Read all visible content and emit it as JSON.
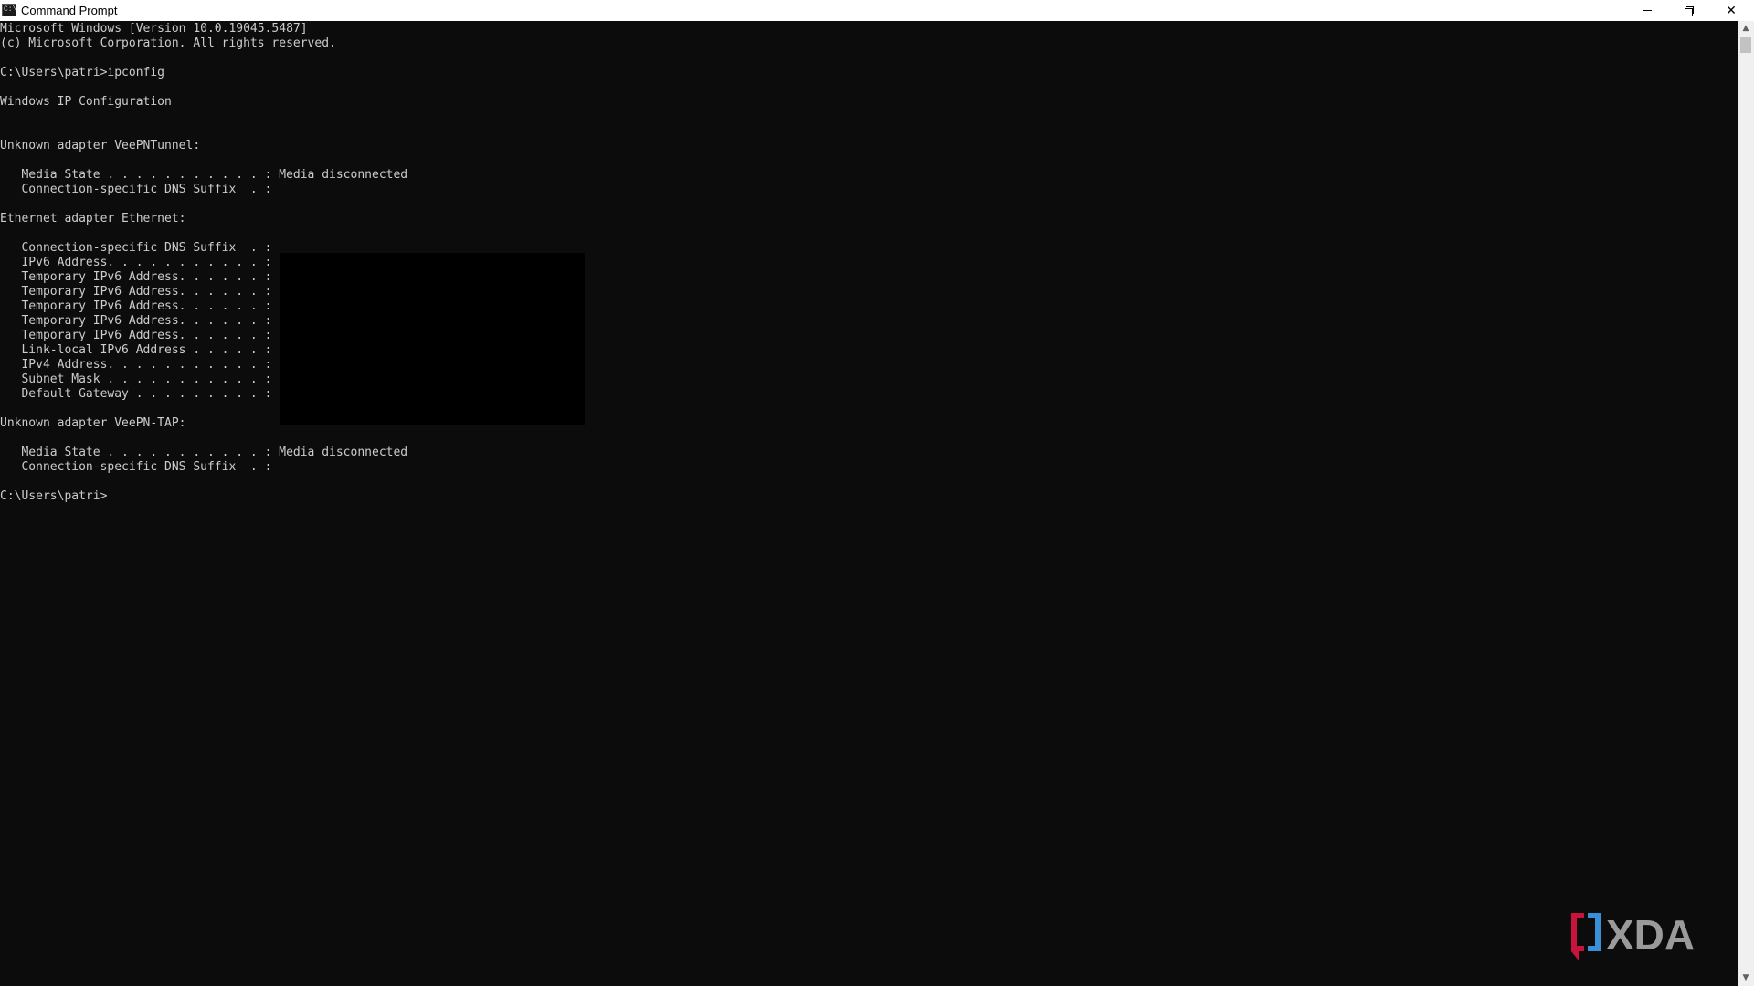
{
  "window": {
    "title": "Command Prompt",
    "icon_glyph": "C:\\",
    "close_glyph": "✕"
  },
  "console": {
    "lines": [
      "Microsoft Windows [Version 10.0.19045.5487]",
      "(c) Microsoft Corporation. All rights reserved.",
      "",
      "C:\\Users\\patri>ipconfig",
      "",
      "Windows IP Configuration",
      "",
      "",
      "Unknown adapter VeePNTunnel:",
      "",
      "   Media State . . . . . . . . . . . : Media disconnected",
      "   Connection-specific DNS Suffix  . :",
      "",
      "Ethernet adapter Ethernet:",
      "",
      "   Connection-specific DNS Suffix  . :",
      "   IPv6 Address. . . . . . . . . . . :",
      "   Temporary IPv6 Address. . . . . . :",
      "   Temporary IPv6 Address. . . . . . :",
      "   Temporary IPv6 Address. . . . . . :",
      "   Temporary IPv6 Address. . . . . . :",
      "   Temporary IPv6 Address. . . . . . :",
      "   Link-local IPv6 Address . . . . . :",
      "   IPv4 Address. . . . . . . . . . . :",
      "   Subnet Mask . . . . . . . . . . . :",
      "   Default Gateway . . . . . . . . . :",
      "",
      "Unknown adapter VeePN-TAP:",
      "",
      "   Media State . . . . . . . . . . . : Media disconnected",
      "   Connection-specific DNS Suffix  . :",
      "",
      "C:\\Users\\patri>"
    ]
  },
  "scrollbar": {
    "up_glyph": "▲",
    "down_glyph": "▼"
  },
  "watermark": {
    "logo_text": "XDA",
    "colors": {
      "red": "#c8143c",
      "blue": "#3a8fd6",
      "gray": "#9a9a9a"
    }
  },
  "colors": {
    "console_bg": "#0c0c0c",
    "console_text": "#cccccc",
    "titlebar_bg": "#ffffff"
  }
}
